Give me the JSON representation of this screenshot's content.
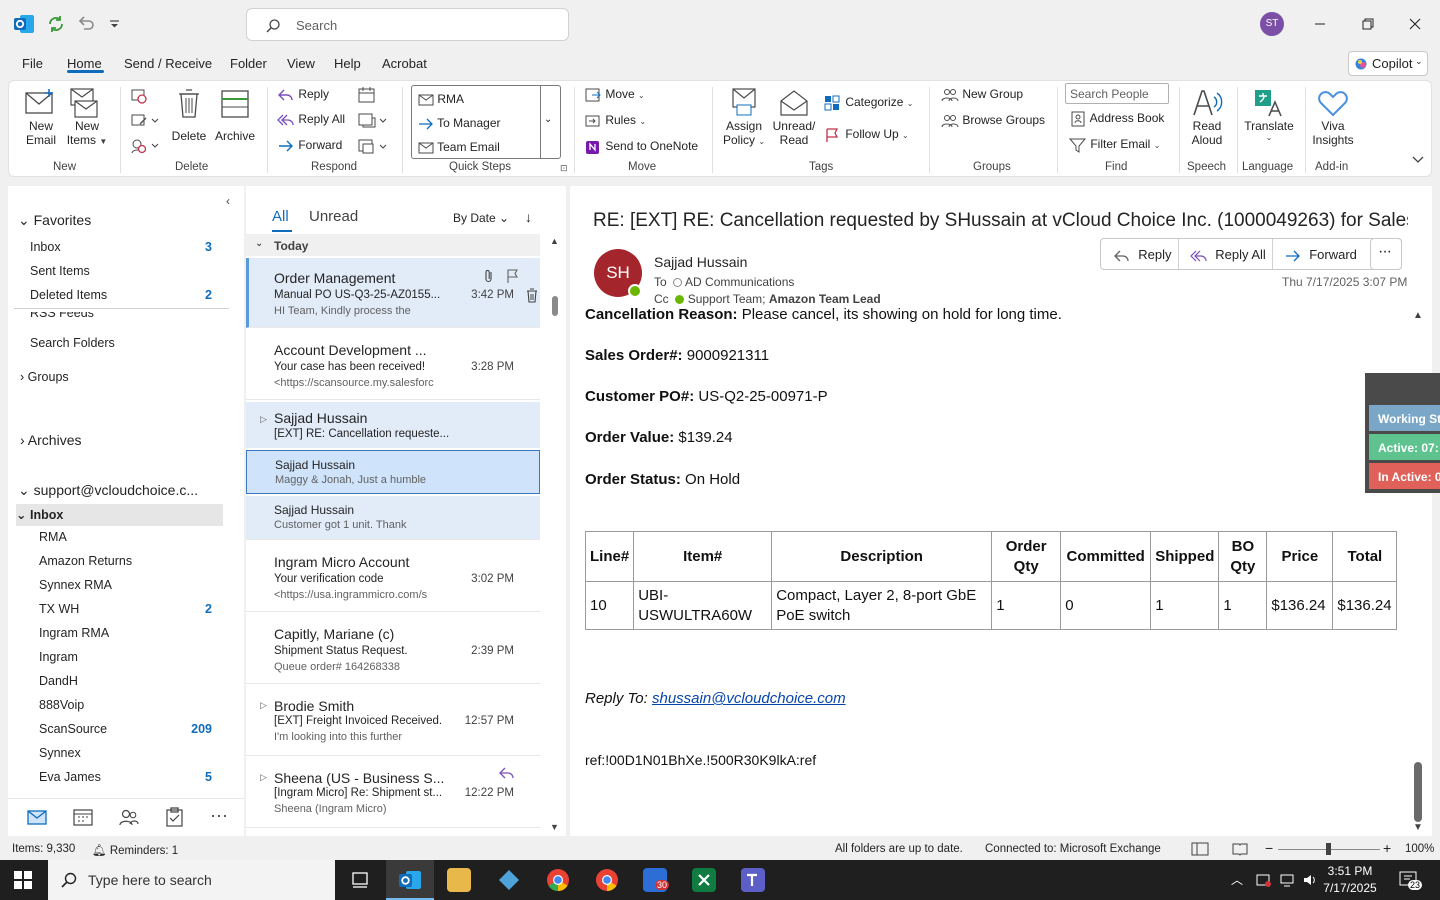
{
  "search": {
    "placeholder": "Search"
  },
  "user_initials": "ST",
  "menu": {
    "file": "File",
    "home": "Home",
    "send_receive": "Send / Receive",
    "folder": "Folder",
    "view": "View",
    "help": "Help",
    "acrobat": "Acrobat",
    "copilot": "Copilot"
  },
  "ribbon": {
    "new": {
      "new_email": [
        "New",
        "Email"
      ],
      "new_items": [
        "New",
        "Items"
      ],
      "label": "New"
    },
    "delete": {
      "delete": "Delete",
      "archive": "Archive",
      "label": "Delete"
    },
    "respond": {
      "reply": "Reply",
      "reply_all": "Reply All",
      "forward": "Forward",
      "label": "Respond"
    },
    "quick_steps": {
      "items": [
        "RMA",
        "To Manager",
        "Team Email"
      ],
      "label": "Quick Steps"
    },
    "move": {
      "move": "Move",
      "rules": "Rules",
      "onenote": "Send to OneNote",
      "label": "Move"
    },
    "tags": {
      "assign_policy": [
        "Assign",
        "Policy"
      ],
      "unread_read": [
        "Unread/",
        "Read"
      ],
      "categorize": "Categorize",
      "follow_up": "Follow Up",
      "label": "Tags"
    },
    "groups": {
      "new_group": "New Group",
      "browse_groups": "Browse Groups",
      "label": "Groups"
    },
    "find": {
      "search_people": "Search People",
      "address_book": "Address Book",
      "filter_email": "Filter Email",
      "label": "Find"
    },
    "speech": {
      "read_aloud": [
        "Read",
        "Aloud"
      ],
      "label": "Speech"
    },
    "language": {
      "translate": "Translate",
      "label": "Language"
    },
    "addin": {
      "viva": [
        "Viva",
        "Insights"
      ],
      "label": "Add-in"
    }
  },
  "folders": {
    "favorites": "Favorites",
    "fav_items": [
      {
        "name": "Inbox",
        "count": "3"
      },
      {
        "name": "Sent Items",
        "count": ""
      },
      {
        "name": "Deleted Items",
        "count": "2"
      }
    ],
    "rss": "RSS Feeds",
    "search_folders": "Search Folders",
    "groups": "Groups",
    "archives": "Archives",
    "account": "support@vcloudchoice.c...",
    "inbox": "Inbox",
    "sub": [
      {
        "name": "RMA",
        "count": ""
      },
      {
        "name": "Amazon Returns",
        "count": ""
      },
      {
        "name": "Synnex RMA",
        "count": ""
      },
      {
        "name": "TX WH",
        "count": "2"
      },
      {
        "name": "Ingram RMA",
        "count": ""
      },
      {
        "name": "Ingram",
        "count": ""
      },
      {
        "name": "DandH",
        "count": ""
      },
      {
        "name": "888Voip",
        "count": ""
      },
      {
        "name": "ScanSource",
        "count": "209"
      },
      {
        "name": "Synnex",
        "count": ""
      },
      {
        "name": "Eva James",
        "count": "5"
      }
    ]
  },
  "list": {
    "tab_all": "All",
    "tab_unread": "Unread",
    "sort": "By Date",
    "group_today": "Today",
    "messages": [
      {
        "sender": "Order Management",
        "subject": "Manual PO   US-Q3-25-AZ0155...",
        "preview": "HI Team,  Kindly process the",
        "time": "3:42 PM"
      },
      {
        "sender": "Account Development ...",
        "subject": "Your case has been received!",
        "preview": "<https://scansource.my.salesforc",
        "time": "3:28 PM"
      },
      {
        "sender": "Sajjad Hussain",
        "subject": "[EXT] RE: Cancellation requeste...",
        "preview": "",
        "time": ""
      },
      {
        "sender": "Sajjad Hussain",
        "subject": "Maggy & Jonah, Just a humble",
        "preview": "",
        "time": ""
      },
      {
        "sender": "Sajjad Hussain",
        "subject": "Customer got 1 unit.  Thank",
        "preview": "",
        "time": ""
      },
      {
        "sender": "Ingram Micro Account",
        "subject": "Your verification code",
        "preview": "<https://usa.ingrammicro.com/s",
        "time": "3:02 PM"
      },
      {
        "sender": "Capitly, Mariane (c)",
        "subject": "Shipment Status Request.",
        "preview": "Queue order# 164268338",
        "time": "2:39 PM"
      },
      {
        "sender": "Brodie Smith",
        "subject": "[EXT] Freight Invoiced Received...",
        "preview": "I'm looking into this further",
        "time": "12:57 PM"
      },
      {
        "sender": "Sheena (US - Business S...",
        "subject": "[Ingram Micro] Re: Shipment st...",
        "preview": "Sheena (Ingram Micro)",
        "time": "12:22 PM"
      }
    ]
  },
  "reading": {
    "subject": "RE: [EXT] RE: Cancellation requested by SHussain at vCloud Choice Inc. (1000049263) for Sales ...",
    "avatar": "SH",
    "from": "Sajjad Hussain",
    "to_label": "To",
    "to": "AD Communications",
    "cc_label": "Cc",
    "cc": "Support Team; ",
    "cc_bold": "Amazon Team Lead",
    "date": "Thu 7/17/2025 3:07 PM",
    "actions": {
      "reply": "Reply",
      "reply_all": "Reply All",
      "forward": "Forward"
    },
    "body": {
      "reason_label": "Cancellation Reason:",
      "reason": " Please cancel, its showing on hold for long time.",
      "so_label": "Sales Order#:",
      "so": " 9000921311",
      "po_label": "Customer PO#:",
      "po": " US-Q2-25-00971-P",
      "value_label": "Order Value:",
      "value": " $139.24",
      "status_label": "Order Status:",
      "status": " On Hold",
      "table_headers": [
        [
          "Line#"
        ],
        [
          "Item#"
        ],
        [
          "Description"
        ],
        [
          "Order",
          "Qty"
        ],
        [
          "Committed"
        ],
        [
          "Shipped"
        ],
        [
          "BO",
          "Qty"
        ],
        [
          "Price"
        ],
        [
          "Total"
        ]
      ],
      "table_row": {
        "line": "10",
        "item1": "UBI-",
        "item2": "USWULTRA60W",
        "desc1": "Compact, Layer 2, 8-port GbE",
        "desc2": "PoE switch",
        "order_qty": "1",
        "committed": "0",
        "shipped": "1",
        "bo_qty": "1",
        "price": "$136.24",
        "total": "$136.24"
      },
      "reply_to_label": "Reply To: ",
      "reply_to": "shussain@vcloudchoice.com",
      "ref": "ref:!00D1N01BhXe.!500R30K9lkA:ref"
    }
  },
  "widget": {
    "working": "Working St",
    "active": "Active: 07:",
    "inactive": "In Active: 0"
  },
  "status": {
    "items": "Items: 9,330",
    "reminders": "Reminders: 1",
    "sync": "All folders are up to date.",
    "connected": "Connected to: Microsoft Exchange",
    "zoom": "100%"
  },
  "taskbar": {
    "search": "Type here to search",
    "time": "3:51 PM",
    "date": "7/17/2025",
    "notif_count": "23",
    "badge": "30"
  }
}
